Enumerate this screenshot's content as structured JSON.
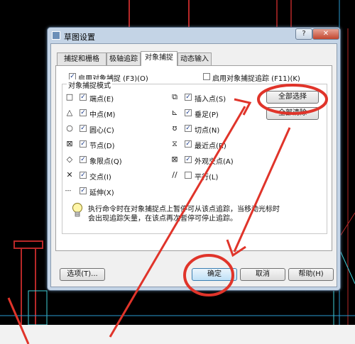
{
  "dialog": {
    "title": "草图设置",
    "help_button": "?",
    "close_button": "✕"
  },
  "tabs": [
    {
      "label": "捕捉和栅格"
    },
    {
      "label": "极轴追踪"
    },
    {
      "label": "对象捕捉"
    },
    {
      "label": "动态输入"
    }
  ],
  "panel": {
    "enable_snap": {
      "label": "启用对象捕捉 (F3)(O)",
      "checked": true
    },
    "enable_tracking": {
      "label": "启用对象捕捉追踪 (F11)(K)",
      "checked": false
    },
    "group_title": "对象捕捉模式",
    "modes_left": [
      {
        "symbol": "□",
        "label": "端点(E)",
        "checked": true
      },
      {
        "symbol": "△",
        "label": "中点(M)",
        "checked": true
      },
      {
        "symbol": "○",
        "label": "圆心(C)",
        "checked": true
      },
      {
        "symbol": "⊠",
        "label": "节点(D)",
        "checked": true
      },
      {
        "symbol": "◇",
        "label": "象限点(Q)",
        "checked": true
      },
      {
        "symbol": "✕",
        "label": "交点(I)",
        "checked": true
      },
      {
        "symbol": "---",
        "label": "延伸(X)",
        "checked": true
      }
    ],
    "modes_right": [
      {
        "symbol": "⧉",
        "label": "插入点(S)",
        "checked": true
      },
      {
        "symbol": "⊾",
        "label": "垂足(P)",
        "checked": true
      },
      {
        "symbol": "ʊ",
        "label": "切点(N)",
        "checked": true
      },
      {
        "symbol": "⧖",
        "label": "最近点(R)",
        "checked": true
      },
      {
        "symbol": "⊠",
        "label": "外观交点(A)",
        "checked": true
      },
      {
        "symbol": "//",
        "label": "平行(L)",
        "checked": false
      }
    ],
    "select_all": "全部选择",
    "clear_all": "全部清除",
    "note_line1": "执行命令时在对象捕捉点上暂停可从该点追踪，当移动光标时",
    "note_line2": "会出现追踪矢量，在该点再次暂停可停止追踪。"
  },
  "footer": {
    "options": "选项(T)...",
    "ok": "确定",
    "cancel": "取消",
    "help": "帮助(H)"
  },
  "colors": {
    "annotation": "#e0342a",
    "cad_lines": "#c03030",
    "cad_cyan": "#3fd0d8"
  }
}
